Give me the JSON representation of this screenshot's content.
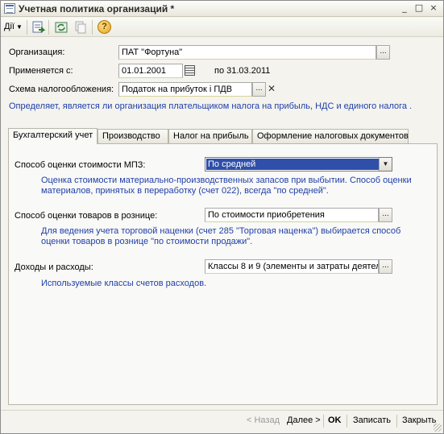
{
  "window": {
    "title": "Учетная политика организаций *",
    "controls": [
      "_",
      "□",
      "×"
    ]
  },
  "toolbar": {
    "actions_label": "Дії",
    "help_label": "?"
  },
  "form": {
    "organization_label": "Организация:",
    "organization_value": "ПАТ \"Фортуна\"",
    "applied_label": "Применяется с:",
    "applied_date": "01.01.2001",
    "applied_until": "по 31.03.2011",
    "tax_scheme_label": "Схема налогообложения:",
    "tax_scheme_value": "Податок на прибуток і ПДВ",
    "tax_scheme_hint": "Определяет, является ли организация плательщиком налога на прибыль, НДС и единого налога ."
  },
  "tabs": [
    {
      "label": "Бухгалтерский учет"
    },
    {
      "label": "Производство"
    },
    {
      "label": "Налог на прибыль"
    },
    {
      "label": "Оформление налоговых документов"
    }
  ],
  "accounting": {
    "mpz_label": "Способ оценки стоимости МПЗ:",
    "mpz_value": "По средней",
    "mpz_hint_1": "Оценка стоимости материально-производственных запасов при выбытии. Способ оценки",
    "mpz_hint_2": "материалов, принятых в переработку (счет 022), всегда \"по средней\".",
    "retail_label": "Способ оценки товаров в рознице:",
    "retail_value": "По стоимости приобретения",
    "retail_hint_1": "Для ведения учета торговой наценки (счет 285 \"Торговая наценка\") выбирается способ",
    "retail_hint_2": "оценки товаров в рознице \"по стоимости продажи\".",
    "income_label": "Доходы и расходы:",
    "income_value": "Классы 8 и 9 (элементы и затраты деятел",
    "income_hint": "Используемые классы счетов расходов."
  },
  "footer": {
    "back_label": "< Назад",
    "next_label": "Далее >",
    "ok_label": "OK",
    "save_label": "Записать",
    "close_label": "Закрыть"
  },
  "colors": {
    "hint_text": "#1f3fa8",
    "selection": "#2f4fa8",
    "window_bg": "#f4f3ee"
  }
}
